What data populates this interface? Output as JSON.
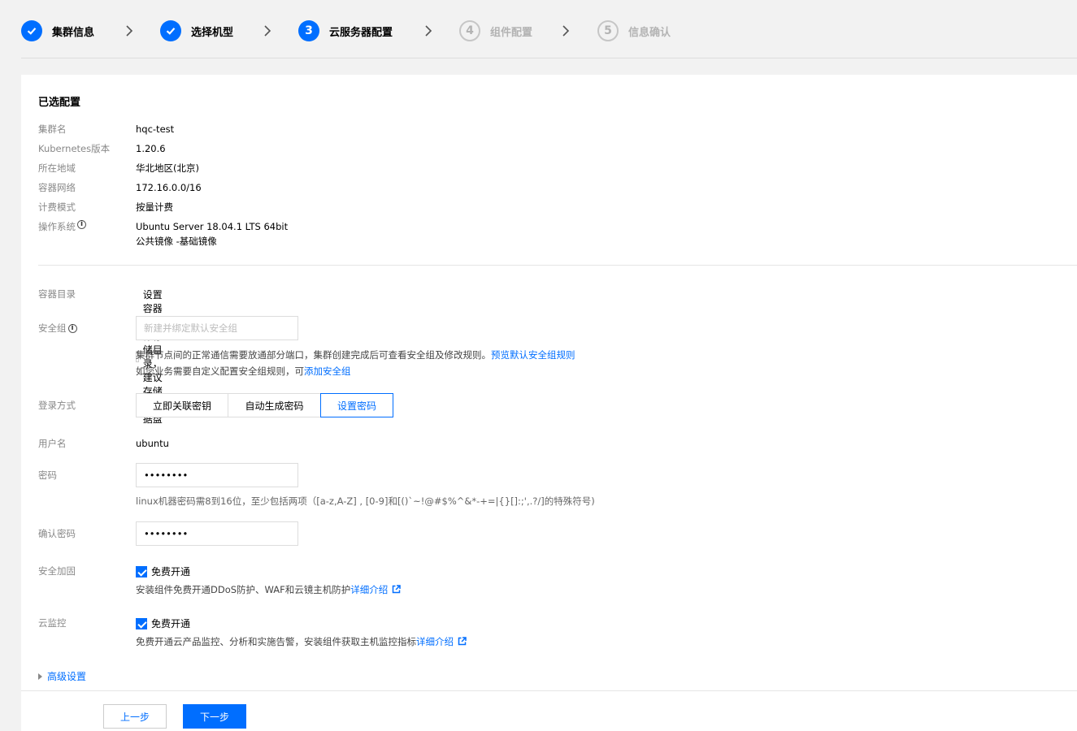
{
  "stepper": {
    "steps": [
      {
        "num": "1",
        "label": "集群信息",
        "state": "done"
      },
      {
        "num": "2",
        "label": "选择机型",
        "state": "done"
      },
      {
        "num": "3",
        "label": "云服务器配置",
        "state": "active"
      },
      {
        "num": "4",
        "label": "组件配置",
        "state": "pending"
      },
      {
        "num": "5",
        "label": "信息确认",
        "state": "pending"
      }
    ]
  },
  "summary": {
    "title": "已选配置",
    "rows": [
      {
        "key": "集群名",
        "value": "hqc-test"
      },
      {
        "key": "Kubernetes版本",
        "value": "1.20.6"
      },
      {
        "key": "所在地域",
        "value": "华北地区(北京)"
      },
      {
        "key": "容器网络",
        "value": "172.16.0.0/16"
      },
      {
        "key": "计费模式",
        "value": "按量计费"
      },
      {
        "key": "操作系统",
        "value": "Ubuntu Server 18.04.1 LTS 64bit",
        "value2": "公共镜像 -基础镜像"
      }
    ]
  },
  "form": {
    "container_dir": {
      "label": "容器目录",
      "checkbox_text": "设置容器和镜像存储目录，建议存储到数据盘"
    },
    "security_group": {
      "label": "安全组",
      "placeholder": "新建并绑定默认安全组",
      "help1": "集群节点间的正常通信需要放通部分端口，集群创建完成后可查看安全组及修改规则。",
      "help1_link": "预览默认安全组规则",
      "help2": "如您业务需要自定义配置安全组规则，可",
      "help2_link": "添加安全组"
    },
    "login": {
      "label": "登录方式",
      "options": [
        "立即关联密钥",
        "自动生成密码",
        "设置密码"
      ],
      "selected": "设置密码"
    },
    "username": {
      "label": "用户名",
      "value": "ubuntu"
    },
    "password": {
      "label": "密码",
      "value": "••••••••",
      "help": "linux机器密码需8到16位，至少包括两项（[a-z,A-Z] , [0-9]和[()`~!@#$%^&*-+=|{}[]:;',.?/]的特殊符号)"
    },
    "confirm_password": {
      "label": "确认密码",
      "value": "••••••••"
    },
    "security_hardening": {
      "label": "安全加固",
      "checkbox_text": "免费开通",
      "help": "安装组件免费开通DDoS防护、WAF和云镜主机防护",
      "link": "详细介绍"
    },
    "cloud_monitor": {
      "label": "云监控",
      "checkbox_text": "免费开通",
      "help": "免费开通云产品监控、分析和实施告警，安装组件获取主机监控指标",
      "link": "详细介绍"
    },
    "advanced": "高级设置"
  },
  "footer": {
    "prev": "上一步",
    "next": "下一步"
  },
  "colors": {
    "accent": "#006eff",
    "pending": "#b3b3b3"
  }
}
